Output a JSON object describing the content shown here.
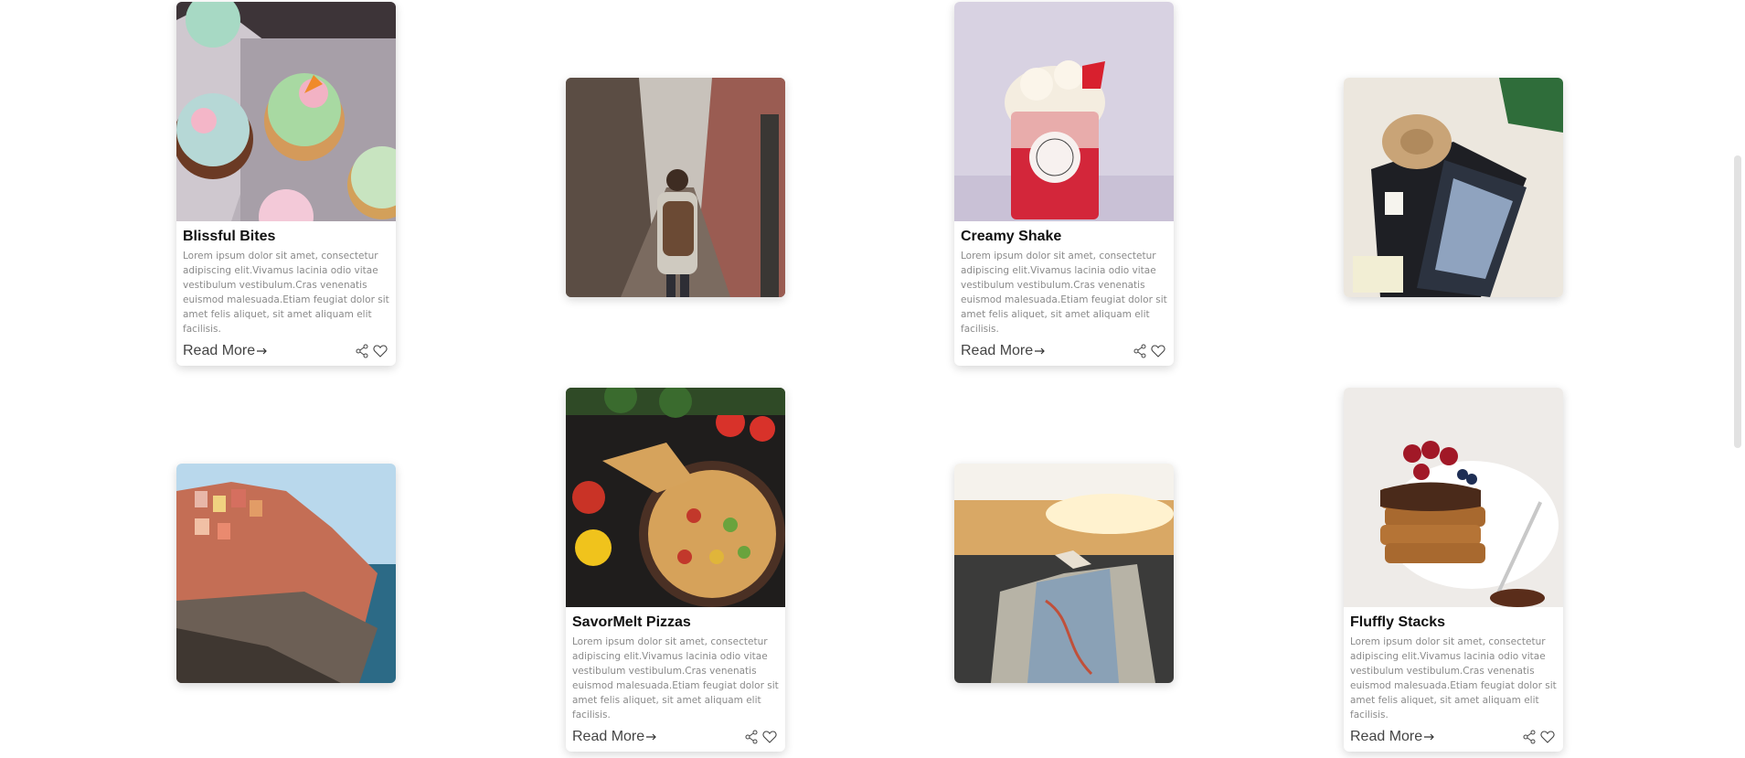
{
  "cards": [
    {
      "title": "Blissful Bites",
      "desc": "Lorem ipsum dolor sit amet, consectetur adipiscing elit.Vivamus lacinia odio vitae vestibulum vestibulum.Cras venenatis euismod malesuada.Etiam feugiat dolor sit amet felis aliquet, sit amet aliquam elit facilisis.",
      "read_more": "Read More",
      "image": "cupcakes"
    },
    {
      "title": "Creamy Shake",
      "desc": "Lorem ipsum dolor sit amet, consectetur adipiscing elit.Vivamus lacinia odio vitae vestibulum vestibulum.Cras venenatis euismod malesuada.Etiam feugiat dolor sit amet felis aliquet, sit amet aliquam elit facilisis.",
      "read_more": "Read More",
      "image": "milkshake"
    },
    {
      "title": "SavorMelt Pizzas",
      "desc": "Lorem ipsum dolor sit amet, consectetur adipiscing elit.Vivamus lacinia odio vitae vestibulum vestibulum.Cras venenatis euismod malesuada.Etiam feugiat dolor sit amet felis aliquet, sit amet aliquam elit facilisis.",
      "read_more": "Read More",
      "image": "pizza"
    },
    {
      "title": "Fluffly Stacks",
      "desc": "Lorem ipsum dolor sit amet, consectetur adipiscing elit.Vivamus lacinia odio vitae vestibulum vestibulum.Cras venenatis euismod malesuada.Etiam feugiat dolor sit amet felis aliquet, sit amet aliquam elit facilisis.",
      "read_more": "Read More",
      "image": "waffles"
    }
  ],
  "photos": [
    {
      "image": "alley-backpacker"
    },
    {
      "image": "suitcase-travel"
    },
    {
      "image": "cliff-village"
    },
    {
      "image": "map-dashboard"
    }
  ],
  "icons": {
    "arrow": "right-arrow-icon",
    "share": "share-icon",
    "like": "heart-icon"
  }
}
